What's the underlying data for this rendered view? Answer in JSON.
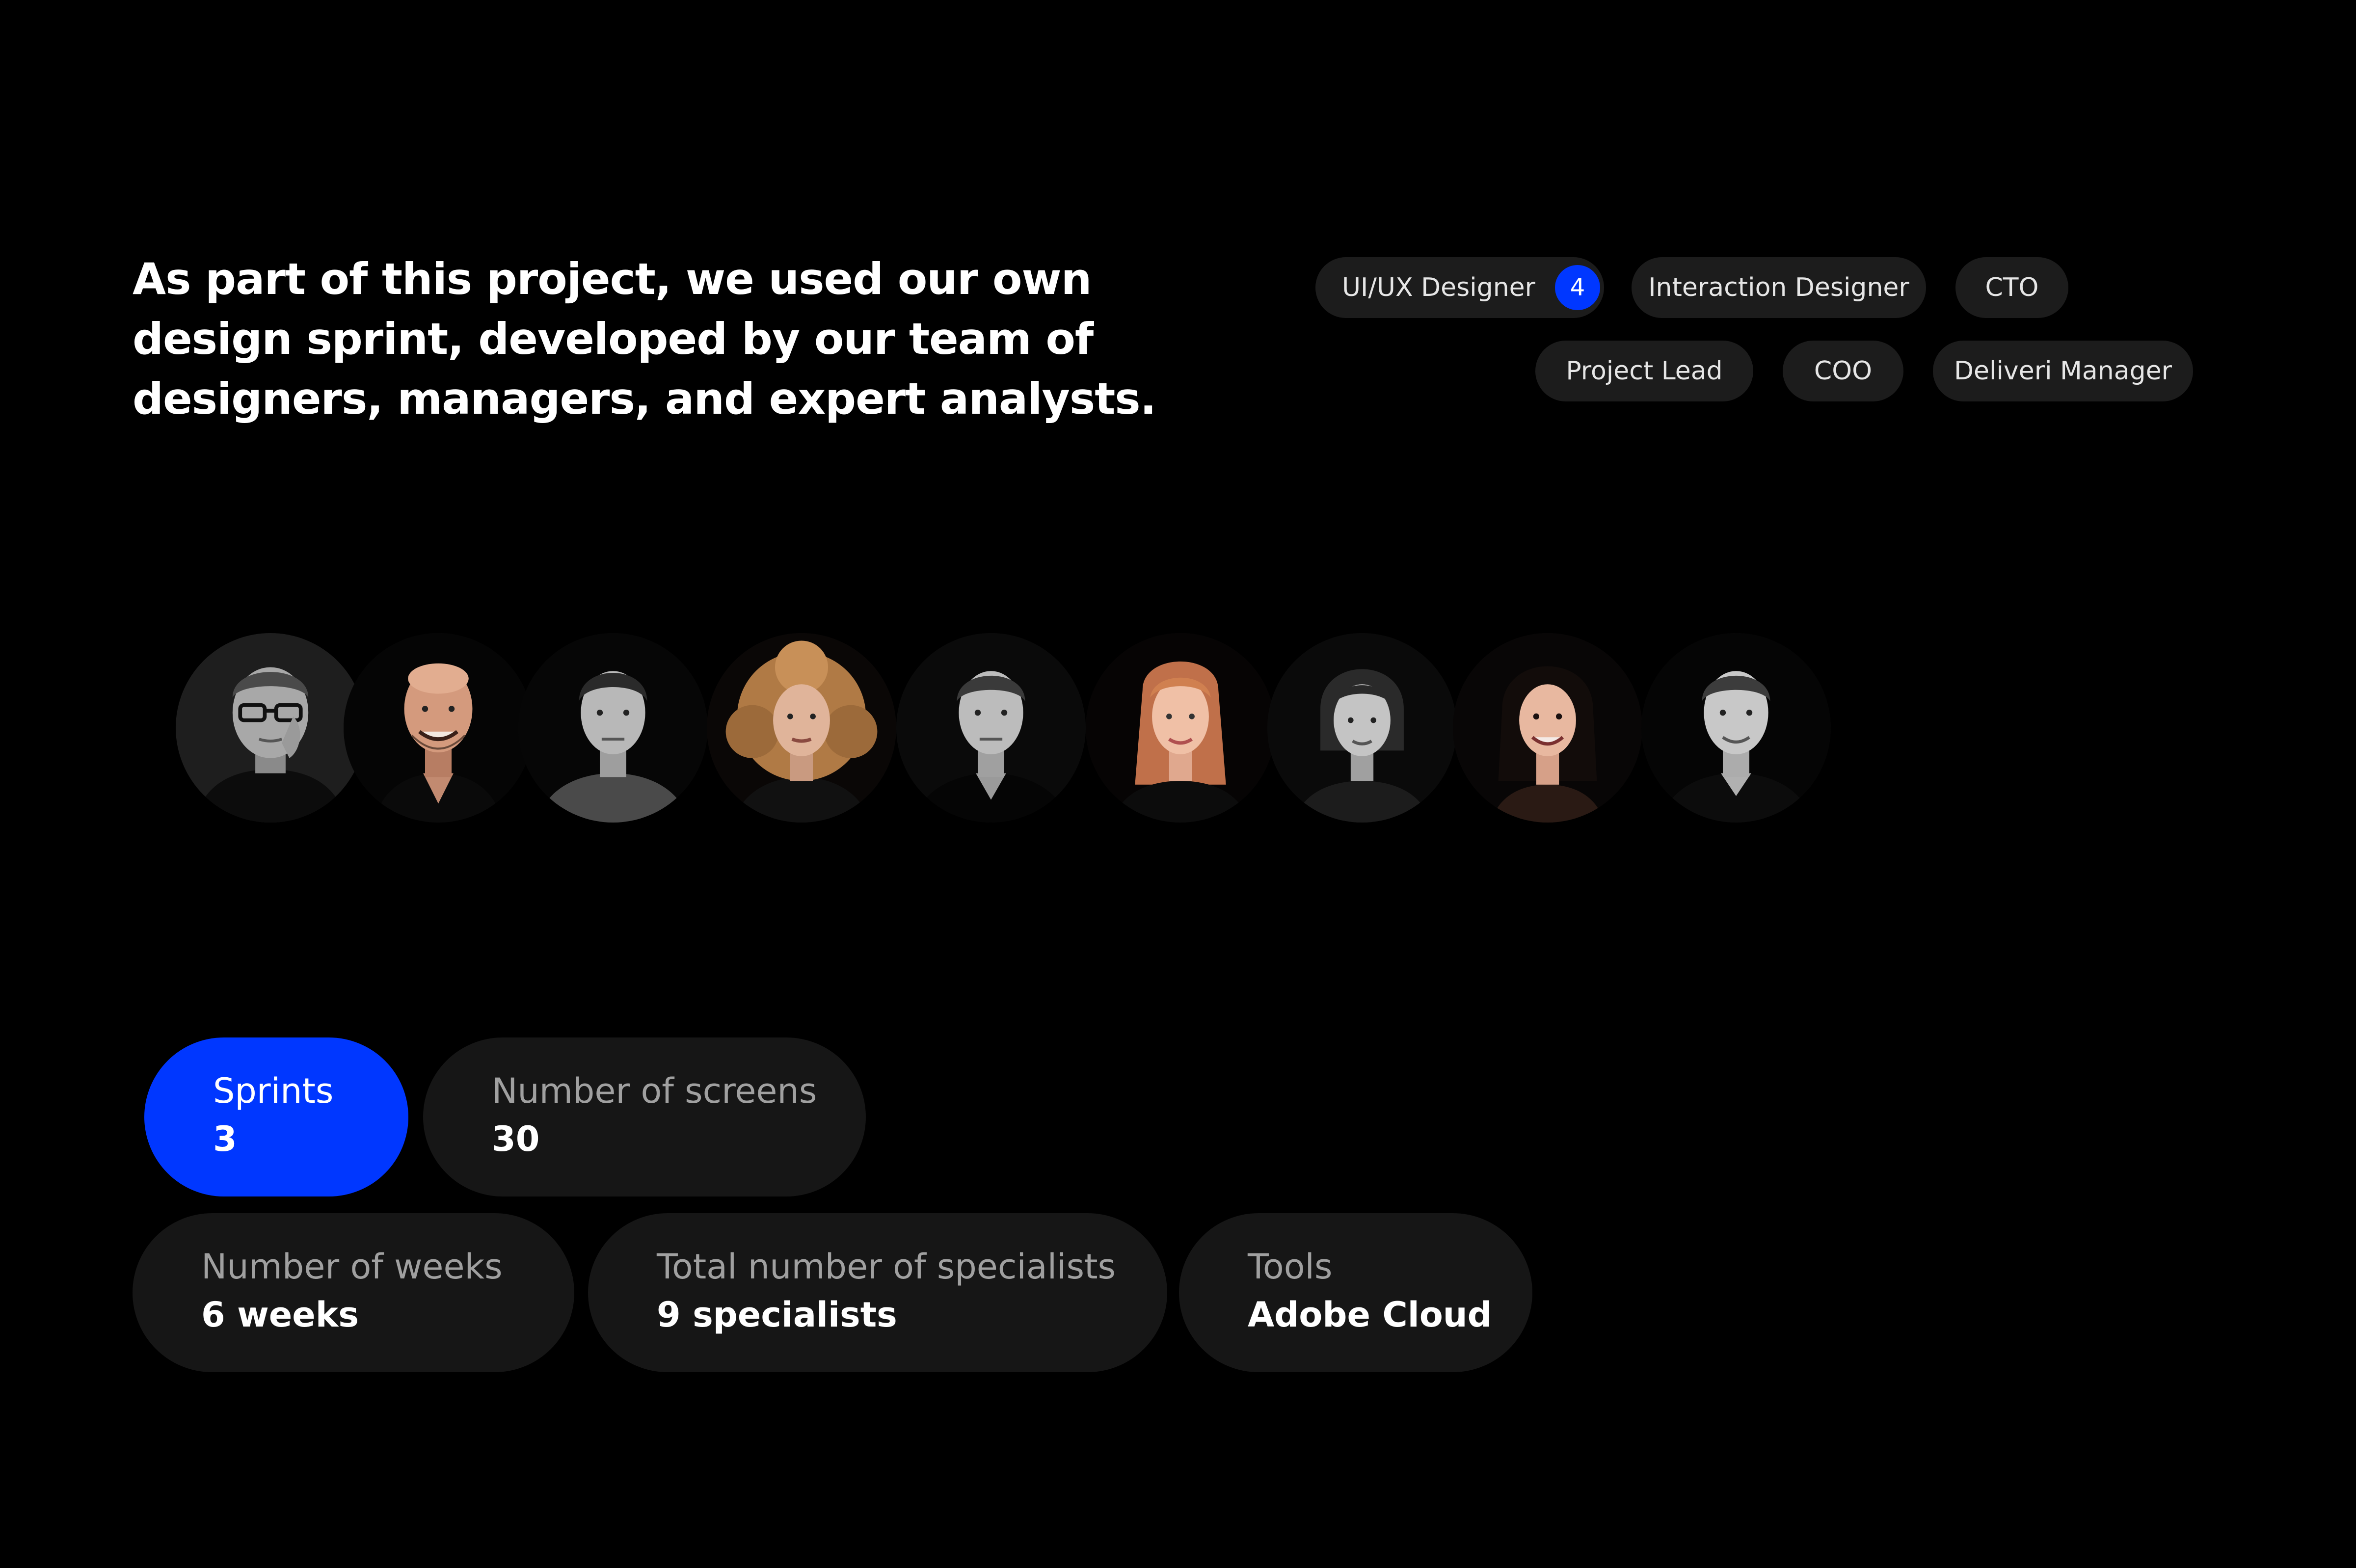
{
  "headline": {
    "lines": [
      "As part of this project, we used our own",
      "design sprint, developed by our team of",
      "designers, managers, and expert analysts."
    ]
  },
  "roles": [
    {
      "label": "UI/UX Designer",
      "badge": "4"
    },
    {
      "label": "Interaction Designer"
    },
    {
      "label": "CTO"
    },
    {
      "label": "Project Lead"
    },
    {
      "label": "COO"
    },
    {
      "label": "Deliveri Manager"
    }
  ],
  "team": [
    {
      "photo": "avatar-man-glasses"
    },
    {
      "photo": "avatar-man-bald-smiling"
    },
    {
      "photo": "avatar-man-short-hair"
    },
    {
      "photo": "avatar-woman-curly-hair"
    },
    {
      "photo": "avatar-man-short-hair-2"
    },
    {
      "photo": "avatar-woman-red-hair"
    },
    {
      "photo": "avatar-woman-bob-hair"
    },
    {
      "photo": "avatar-woman-dark-hair"
    },
    {
      "photo": "avatar-man-young"
    }
  ],
  "stats": [
    {
      "label": "Sprints",
      "value": "3"
    },
    {
      "label": "Number of screens",
      "value": "30"
    },
    {
      "label": "Number of weeks",
      "value": "6 weeks"
    },
    {
      "label": "Total number of specialists",
      "value": "9 specialists"
    },
    {
      "label": "Tools",
      "value": "Adobe Cloud"
    }
  ],
  "colors": {
    "background": "#000000",
    "accent": "#0037ff",
    "pill": "#161616",
    "tag": "#1c1c1c",
    "muted_text": "#a0a0a0"
  }
}
